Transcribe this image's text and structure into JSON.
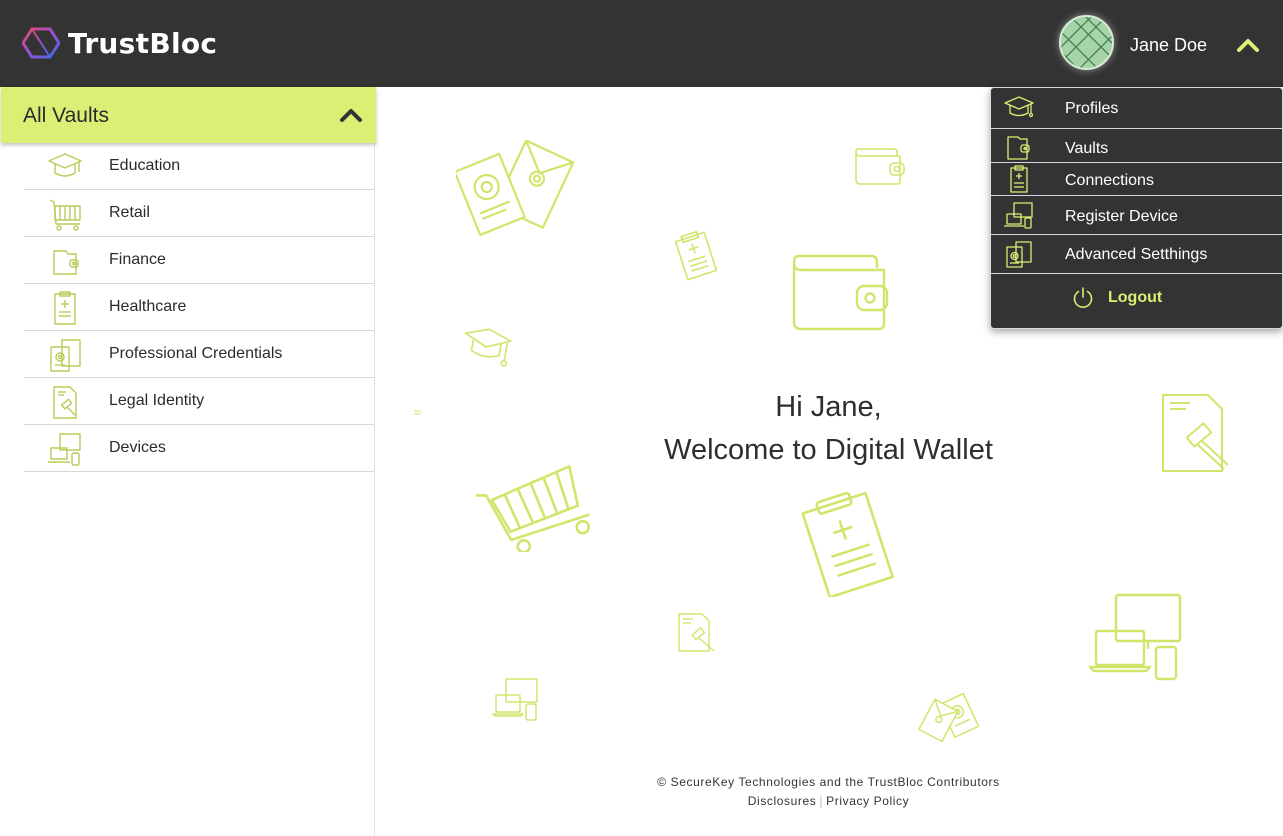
{
  "header": {
    "brand": "TrustBloc",
    "user_name": "Jane Doe"
  },
  "sidebar": {
    "title": "All Vaults",
    "items": [
      {
        "label": "Education",
        "icon": "graduation-cap-icon"
      },
      {
        "label": "Retail",
        "icon": "shopping-cart-icon"
      },
      {
        "label": "Finance",
        "icon": "wallet-icon"
      },
      {
        "label": "Healthcare",
        "icon": "medical-clipboard-icon"
      },
      {
        "label": "Professional Credentials",
        "icon": "credentials-icon"
      },
      {
        "label": "Legal Identity",
        "icon": "legal-document-icon"
      },
      {
        "label": "Devices",
        "icon": "devices-icon"
      }
    ]
  },
  "main": {
    "greeting_line1": "Hi Jane,",
    "greeting_line2": "Welcome to Digital Wallet"
  },
  "footer": {
    "copyright": "© SecureKey Technologies and the TrustBloc Contributors",
    "disclosures": "Disclosures",
    "privacy": "Privacy Policy"
  },
  "user_menu": {
    "items": [
      {
        "label": "Profiles",
        "icon": "graduation-cap-icon"
      },
      {
        "label": "Vaults",
        "icon": "wallet-icon"
      },
      {
        "label": "Connections",
        "icon": "clipboard-icon"
      },
      {
        "label": "Register Device",
        "icon": "devices-icon"
      },
      {
        "label": "Advanced Setthings",
        "icon": "credentials-icon"
      }
    ],
    "logout": "Logout"
  },
  "colors": {
    "accent": "#dcef74",
    "header_bg": "#333333",
    "icon_stroke": "#d2e46a"
  }
}
